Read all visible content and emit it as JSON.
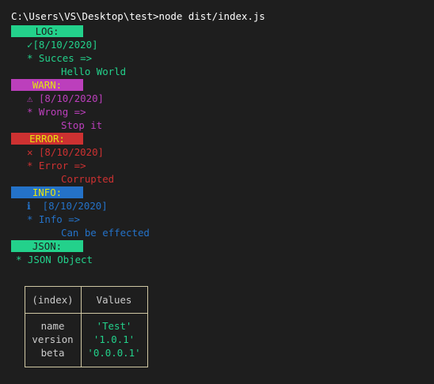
{
  "colors": {
    "background": "#1e1e1e",
    "text": "#cccccc",
    "log": "#23d18b",
    "warn": "#bc3fbc",
    "error": "#cd3131",
    "info": "#2472c8",
    "string": "#23d18b",
    "border": "#cfc7a3"
  },
  "command": "C:\\Users\\VS\\Desktop\\test>node dist/index.js",
  "sections": {
    "log": {
      "badge": "LOG:",
      "icon": "✓",
      "icon_name": "check-icon",
      "date": "[8/10/2020]",
      "label": "* Succes =>",
      "message": "Hello World"
    },
    "warn": {
      "badge": "WARN:",
      "icon": "⚠",
      "icon_name": "warning-icon",
      "date": "[8/10/2020]",
      "label": "* Wrong =>",
      "message": "Stop it"
    },
    "error": {
      "badge": "ERROR:",
      "icon": "✕",
      "icon_name": "cross-icon",
      "date": "[8/10/2020]",
      "label": "* Error =>",
      "message": "Corrupted"
    },
    "info": {
      "badge": "INFO:",
      "icon": "ℹ",
      "icon_name": "info-icon",
      "date": "[8/10/2020]",
      "label": "* Info =>",
      "message": "Can be effected"
    },
    "json": {
      "badge": "JSON:",
      "label": "* JSON Object"
    }
  },
  "table": {
    "headers": [
      "(index)",
      "Values"
    ],
    "rows": [
      {
        "index": "name",
        "value": "'Test'"
      },
      {
        "index": "version",
        "value": "'1.0.1'"
      },
      {
        "index": "beta",
        "value": "'0.0.0.1'"
      }
    ]
  }
}
